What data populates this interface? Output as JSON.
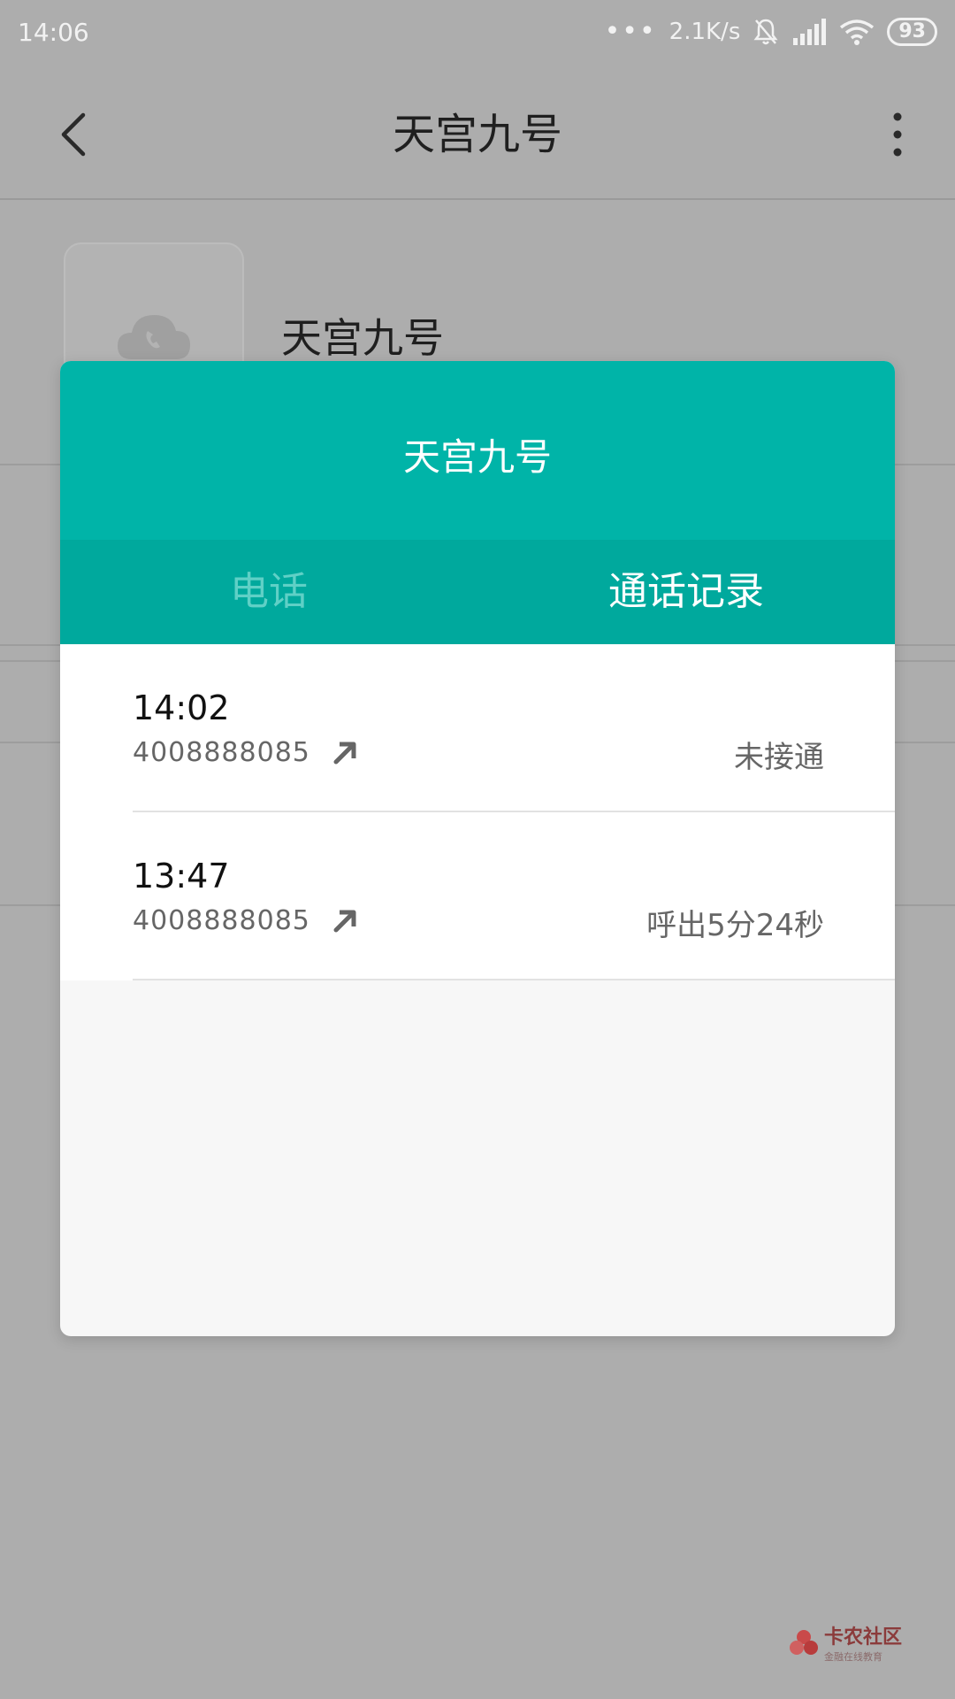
{
  "status_bar": {
    "time": "14:06",
    "dots": "•••",
    "network_speed": "2.1K/s",
    "battery": "93"
  },
  "header": {
    "title": "天宫九号"
  },
  "contact": {
    "name": "天宫九号"
  },
  "dialog": {
    "title": "天宫九号",
    "tabs": [
      {
        "label": "电话",
        "active": false
      },
      {
        "label": "通话记录",
        "active": true
      }
    ],
    "calls": [
      {
        "time": "14:02",
        "number": "4008888085",
        "status": "未接通",
        "direction_icon": "outgoing-arrow-icon"
      },
      {
        "time": "13:47",
        "number": "4008888085",
        "status": "呼出5分24秒",
        "direction_icon": "outgoing-arrow-icon"
      }
    ]
  },
  "watermark": {
    "main": "卡农社区",
    "sub": "金融在线教育"
  },
  "colors": {
    "accent": "#00b4a8",
    "tab_bar": "#00a99d",
    "inactive_tab": "#5fd0c6",
    "overlay_bg": "#adadad"
  }
}
